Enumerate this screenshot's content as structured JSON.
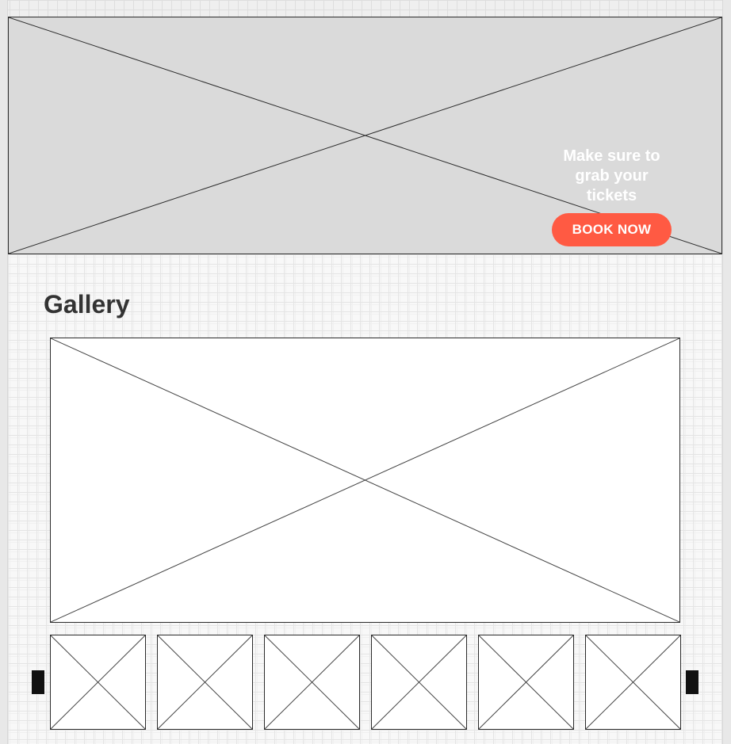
{
  "hero": {
    "tagline": "Make sure to grab your tickets",
    "cta_label": "BOOK NOW",
    "cta_color": "#ff5a43"
  },
  "gallery": {
    "title": "Gallery",
    "thumbnail_count": 6,
    "prev_icon": "arrow-left-icon",
    "next_icon": "arrow-right-icon"
  }
}
